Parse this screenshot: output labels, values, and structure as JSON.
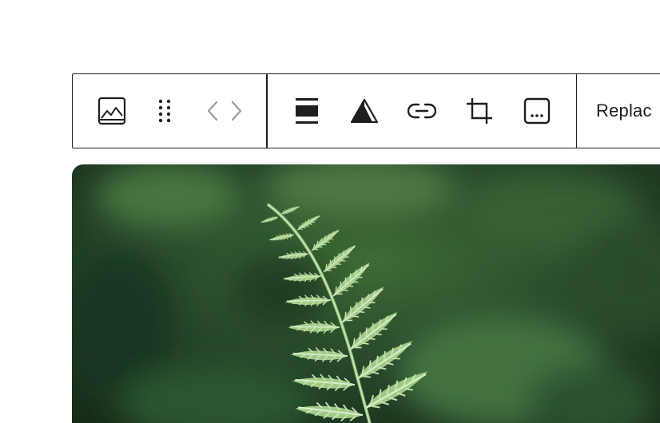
{
  "toolbar": {
    "block_type_icon": "image-icon",
    "drag_handle_icon": "drag-handle-icon",
    "move_icon": "move-left-right-icon",
    "align_icon": "align-wide-icon",
    "duotone_icon": "duotone-filter-icon",
    "link_icon": "link-icon",
    "crop_icon": "crop-icon",
    "text_overlay_icon": "more-text-icon",
    "replace_label": "Replac"
  },
  "image": {
    "subject": "fern-photo",
    "accent_colors": [
      "#1f3d1f",
      "#8ec07a",
      "#5a8a4a"
    ]
  }
}
